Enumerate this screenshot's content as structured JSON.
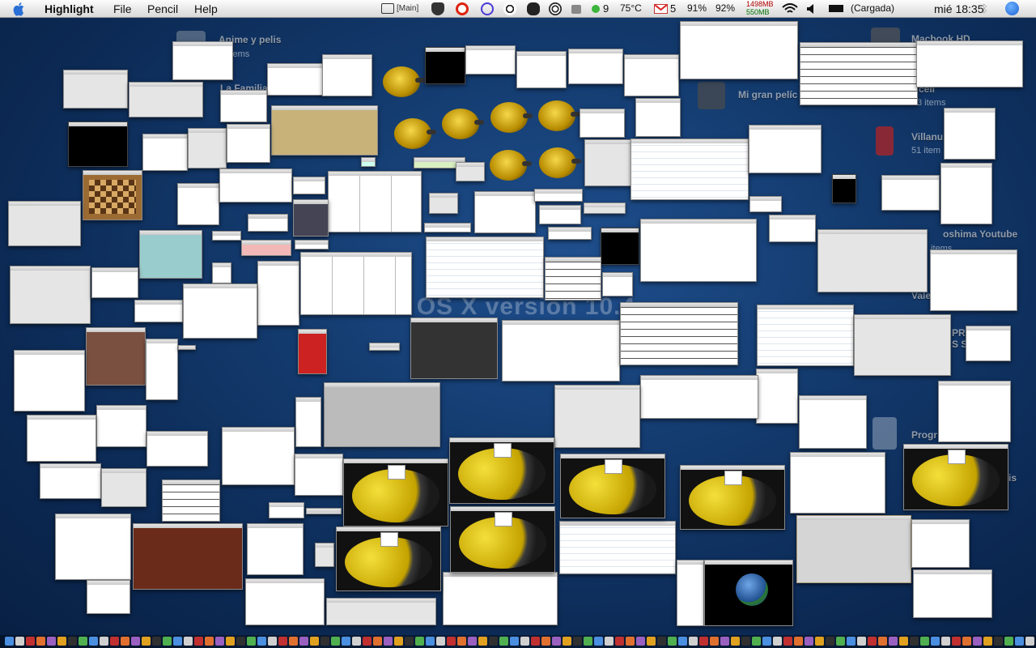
{
  "menubar": {
    "app_name": "Highlight",
    "menus": [
      "File",
      "Pencil",
      "Help"
    ],
    "main_label": "[Main]",
    "cpu_count": "9",
    "temperature": "75°C",
    "mail_count": "5",
    "percent_a": "91%",
    "percent_b": "92%",
    "mem_used": "1498MB",
    "mem_free": "550MB",
    "battery_status": "(Cargada)",
    "clock": "mié 18:35"
  },
  "desktop": {
    "watermark": "ac OS X version 10.4",
    "labels": [
      "Anime y pelis",
      "items",
      "La Familia",
      "Mi gran pelíc",
      "Macbook HD",
      "cell",
      "3 items",
      "Villanu",
      "51 item",
      "oshima Youtube",
      "items",
      "Vale",
      "PR",
      "S S",
      "Progr",
      "is"
    ]
  },
  "colors": {
    "desktop_blue": "#143c70",
    "menubar_bg": "#e6e6e6",
    "game_yellow": "#f4e03a"
  },
  "icons": [
    "apple-icon",
    "screen-icon",
    "spy-icon",
    "no-icon",
    "magnifier-icon",
    "soccer-icon",
    "paw-icon",
    "target-icon",
    "disk-icon",
    "status-dot-icon",
    "gmail-icon",
    "wifi-icon",
    "speaker-icon",
    "battery-icon",
    "bluetooth-icon",
    "spotlight-icon"
  ]
}
